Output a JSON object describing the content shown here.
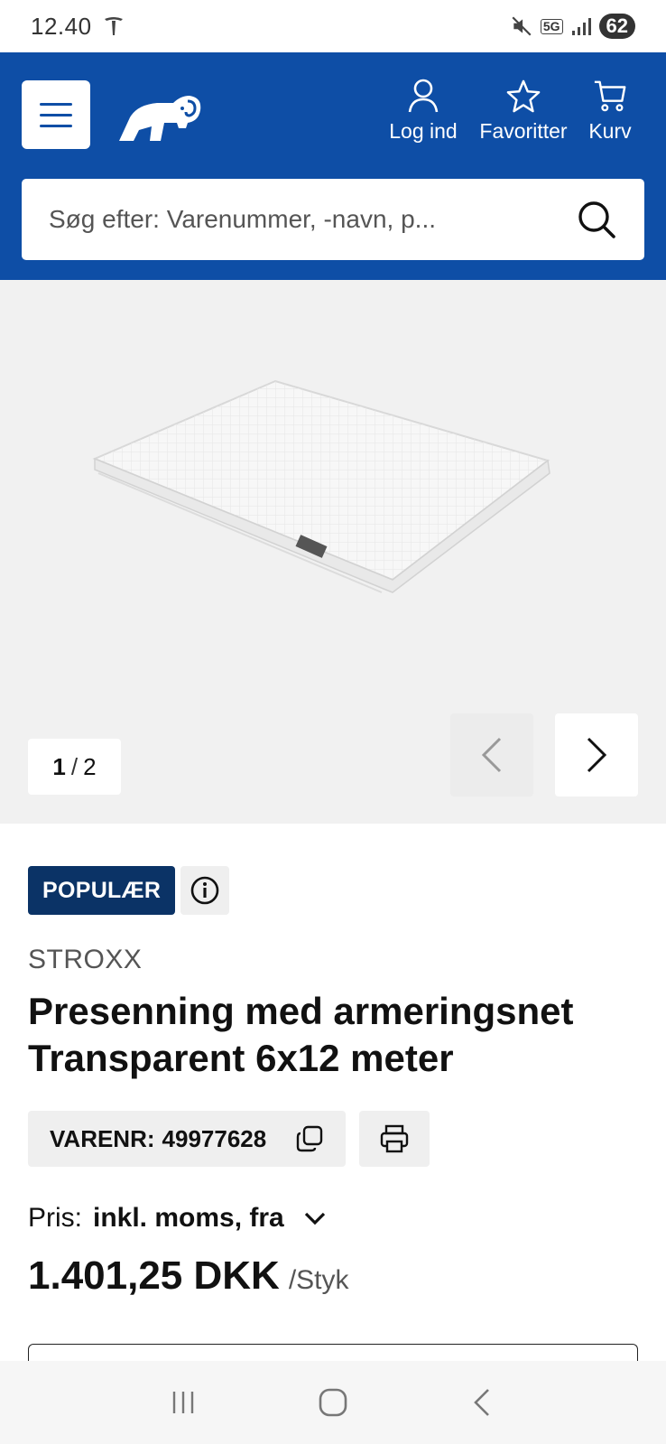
{
  "status_bar": {
    "time": "12.40",
    "network": "5G",
    "battery": "62"
  },
  "header": {
    "menu_icon": "hamburger-icon",
    "logo_icon": "elephant-logo",
    "actions": [
      {
        "label": "Log ind",
        "icon": "user-icon"
      },
      {
        "label": "Favoritter",
        "icon": "star-icon"
      },
      {
        "label": "Kurv",
        "icon": "cart-icon"
      }
    ],
    "search": {
      "placeholder": "Søg efter: Varenummer, -navn, p...",
      "icon": "search-icon"
    }
  },
  "gallery": {
    "current": "1",
    "separator": "/",
    "total": "2"
  },
  "product": {
    "badge": "POPULÆR",
    "brand": "STROXX",
    "title": "Presenning med armeringsnet Transparent 6x12 meter",
    "sku_label": "VARENR:",
    "sku_value": "49977628",
    "price_label": "Pris:",
    "price_mode": "inkl. moms, fra",
    "price_amount": "1.401,25 DKK",
    "price_unit": "/Styk"
  },
  "colors": {
    "brand_blue": "#0e4ea6",
    "badge_navy": "#0b3366"
  }
}
